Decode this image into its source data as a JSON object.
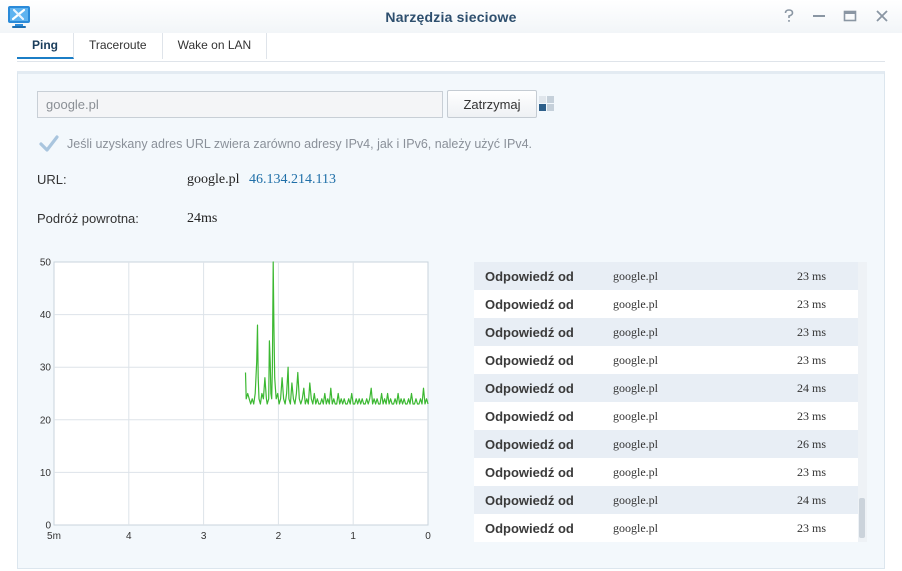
{
  "window": {
    "title": "Narzędzia sieciowe",
    "icons": [
      "network-tools-icon",
      "help-icon",
      "minimize-icon",
      "maximize-icon",
      "close-icon"
    ]
  },
  "tabs": [
    {
      "label": "Ping",
      "active": true
    },
    {
      "label": "Traceroute",
      "active": false
    },
    {
      "label": "Wake on LAN",
      "active": false
    }
  ],
  "ping": {
    "host_value": "google.pl",
    "host_placeholder": "",
    "stop_label": "Zatrzymaj",
    "prefer_ipv4_label": "Jeśli uzyskany adres URL zwiera zarówno adresy IPv4, jak i IPv6, należy użyć IPv4.",
    "prefer_ipv4_checked": true,
    "url_label": "URL:",
    "url_host": "google.pl",
    "url_ip": "46.134.214.113",
    "rtt_label": "Podróż powrotna:",
    "rtt_value": "24ms"
  },
  "results": [
    {
      "label": "Odpowiedź od",
      "host": "google.pl",
      "time": "23 ms"
    },
    {
      "label": "Odpowiedź od",
      "host": "google.pl",
      "time": "23 ms"
    },
    {
      "label": "Odpowiedź od",
      "host": "google.pl",
      "time": "23 ms"
    },
    {
      "label": "Odpowiedź od",
      "host": "google.pl",
      "time": "23 ms"
    },
    {
      "label": "Odpowiedź od",
      "host": "google.pl",
      "time": "24 ms"
    },
    {
      "label": "Odpowiedź od",
      "host": "google.pl",
      "time": "23 ms"
    },
    {
      "label": "Odpowiedź od",
      "host": "google.pl",
      "time": "26 ms"
    },
    {
      "label": "Odpowiedź od",
      "host": "google.pl",
      "time": "23 ms"
    },
    {
      "label": "Odpowiedź od",
      "host": "google.pl",
      "time": "24 ms"
    },
    {
      "label": "Odpowiedź od",
      "host": "google.pl",
      "time": "23 ms"
    }
  ],
  "colors": {
    "accent": "#1b7ec6",
    "line": "#3cb832",
    "panel": "#f3f8fc"
  },
  "chart_data": {
    "type": "line",
    "x_tick_labels": [
      "5m",
      "4",
      "3",
      "2",
      "1",
      "0"
    ],
    "y_tick_labels": [
      "0",
      "10",
      "20",
      "30",
      "40",
      "50"
    ],
    "xlim": [
      5,
      0
    ],
    "ylim": [
      0,
      50
    ],
    "grid": true,
    "series": [
      {
        "color": "#3cb832",
        "points": [
          [
            2.44,
            29
          ],
          [
            2.43,
            24
          ],
          [
            2.41,
            25
          ],
          [
            2.39,
            24
          ],
          [
            2.37,
            23
          ],
          [
            2.35,
            24
          ],
          [
            2.33,
            23
          ],
          [
            2.31,
            25
          ],
          [
            2.29,
            31
          ],
          [
            2.28,
            38
          ],
          [
            2.27,
            28
          ],
          [
            2.26,
            24
          ],
          [
            2.24,
            23
          ],
          [
            2.22,
            25
          ],
          [
            2.2,
            24
          ],
          [
            2.18,
            28
          ],
          [
            2.16,
            24
          ],
          [
            2.15,
            23
          ],
          [
            2.13,
            24
          ],
          [
            2.12,
            35
          ],
          [
            2.11,
            31
          ],
          [
            2.1,
            25
          ],
          [
            2.09,
            24
          ],
          [
            2.08,
            30
          ],
          [
            2.07,
            50
          ],
          [
            2.06,
            38
          ],
          [
            2.05,
            28
          ],
          [
            2.04,
            26
          ],
          [
            2.03,
            24
          ],
          [
            2.01,
            25
          ],
          [
            1.99,
            23
          ],
          [
            1.97,
            24
          ],
          [
            1.95,
            28
          ],
          [
            1.93,
            24
          ],
          [
            1.91,
            23
          ],
          [
            1.89,
            25
          ],
          [
            1.87,
            30
          ],
          [
            1.86,
            24
          ],
          [
            1.84,
            23
          ],
          [
            1.82,
            27
          ],
          [
            1.8,
            24
          ],
          [
            1.78,
            23
          ],
          [
            1.76,
            25
          ],
          [
            1.74,
            29
          ],
          [
            1.72,
            24
          ],
          [
            1.7,
            23
          ],
          [
            1.68,
            24
          ],
          [
            1.66,
            26
          ],
          [
            1.64,
            23
          ],
          [
            1.62,
            24
          ],
          [
            1.6,
            23
          ],
          [
            1.58,
            27
          ],
          [
            1.56,
            24
          ],
          [
            1.54,
            23
          ],
          [
            1.52,
            25
          ],
          [
            1.5,
            23
          ],
          [
            1.48,
            24
          ],
          [
            1.46,
            23
          ],
          [
            1.44,
            23
          ],
          [
            1.42,
            24
          ],
          [
            1.4,
            23
          ],
          [
            1.38,
            25
          ],
          [
            1.36,
            23
          ],
          [
            1.34,
            24
          ],
          [
            1.32,
            23
          ],
          [
            1.3,
            26
          ],
          [
            1.28,
            23
          ],
          [
            1.26,
            24
          ],
          [
            1.24,
            23
          ],
          [
            1.22,
            23
          ],
          [
            1.2,
            25
          ],
          [
            1.18,
            23
          ],
          [
            1.16,
            24
          ],
          [
            1.14,
            23
          ],
          [
            1.12,
            24
          ],
          [
            1.1,
            23
          ],
          [
            1.08,
            23
          ],
          [
            1.06,
            24
          ],
          [
            1.04,
            23
          ],
          [
            1.02,
            25
          ],
          [
            1.0,
            23
          ],
          [
            0.98,
            23
          ],
          [
            0.96,
            24
          ],
          [
            0.94,
            23
          ],
          [
            0.92,
            24
          ],
          [
            0.9,
            23
          ],
          [
            0.88,
            24
          ],
          [
            0.86,
            23
          ],
          [
            0.84,
            23
          ],
          [
            0.82,
            24
          ],
          [
            0.8,
            23
          ],
          [
            0.78,
            24
          ],
          [
            0.76,
            26
          ],
          [
            0.74,
            23
          ],
          [
            0.72,
            24
          ],
          [
            0.7,
            23
          ],
          [
            0.68,
            24
          ],
          [
            0.66,
            23
          ],
          [
            0.64,
            23
          ],
          [
            0.62,
            25
          ],
          [
            0.6,
            23
          ],
          [
            0.58,
            24
          ],
          [
            0.56,
            23
          ],
          [
            0.54,
            25
          ],
          [
            0.52,
            23
          ],
          [
            0.5,
            24
          ],
          [
            0.48,
            23
          ],
          [
            0.46,
            23
          ],
          [
            0.44,
            24
          ],
          [
            0.42,
            23
          ],
          [
            0.4,
            25
          ],
          [
            0.38,
            23
          ],
          [
            0.36,
            24
          ],
          [
            0.34,
            23
          ],
          [
            0.32,
            24
          ],
          [
            0.3,
            23
          ],
          [
            0.28,
            23
          ],
          [
            0.26,
            24
          ],
          [
            0.24,
            23
          ],
          [
            0.22,
            25
          ],
          [
            0.2,
            23
          ],
          [
            0.18,
            23
          ],
          [
            0.16,
            24
          ],
          [
            0.14,
            23
          ],
          [
            0.12,
            23
          ],
          [
            0.1,
            24
          ],
          [
            0.08,
            23
          ],
          [
            0.06,
            26
          ],
          [
            0.04,
            23
          ],
          [
            0.02,
            24
          ],
          [
            0.0,
            23
          ]
        ]
      }
    ]
  }
}
